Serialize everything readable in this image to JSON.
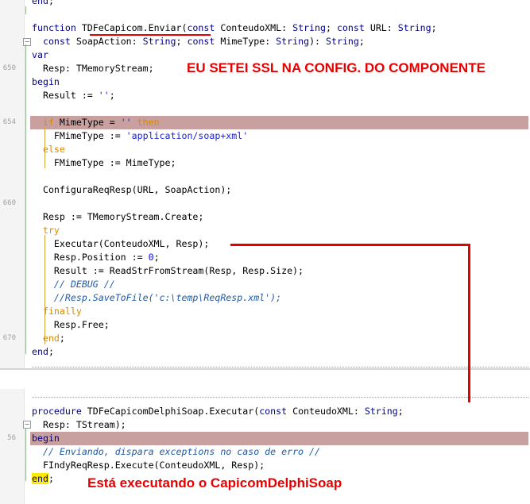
{
  "top": {
    "lines": [
      {
        "ln": "",
        "html": "<span class=\"kw\">end</span>;"
      },
      {
        "ln": "",
        "html": ""
      },
      {
        "ln": "",
        "html": "<span class=\"kw\">function</span> TDFeCapicom.Enviar(<span class=\"kw\">const</span> ConteudoXML: <span class=\"kw\">String</span>; <span class=\"kw\">const</span> URL: <span class=\"kw\">String</span>;"
      },
      {
        "ln": "",
        "html": "  <span class=\"kw\">const</span> SoapAction: <span class=\"kw\">String</span>; <span class=\"kw\">const</span> MimeType: <span class=\"kw\">String</span>): <span class=\"kw\">String</span>;"
      },
      {
        "ln": "",
        "html": "<span class=\"kw\">var</span>"
      },
      {
        "ln": "650",
        "html": "  Resp: TMemoryStream;"
      },
      {
        "ln": "",
        "html": "<span class=\"kw\">begin</span>"
      },
      {
        "ln": "",
        "html": "  Result := <span class=\"str\">''</span>;"
      },
      {
        "ln": "",
        "html": ""
      },
      {
        "ln": "654",
        "html": "  <span class=\"kw-or\">if</span> MimeType = <span class=\"str\">''</span> <span class=\"kw-or\">then</span>"
      },
      {
        "ln": "",
        "html": "    FMimeType := <span class=\"str\">'application/soap+xml'</span>"
      },
      {
        "ln": "",
        "html": "  <span class=\"kw-or\">else</span>"
      },
      {
        "ln": "",
        "html": "    FMimeType := MimeType;"
      },
      {
        "ln": "",
        "html": ""
      },
      {
        "ln": "",
        "html": "  ConfiguraReqResp(URL, SoapAction);"
      },
      {
        "ln": "660",
        "html": ""
      },
      {
        "ln": "",
        "html": "  Resp := TMemoryStream.Create;"
      },
      {
        "ln": "",
        "html": "  <span class=\"kw-or\">try</span>"
      },
      {
        "ln": "",
        "html": "    Executar(ConteudoXML, Resp);"
      },
      {
        "ln": "",
        "html": "    Resp.Position := <span class=\"num\">0</span>;"
      },
      {
        "ln": "",
        "html": "    Result := ReadStrFromStream(Resp, Resp.Size);"
      },
      {
        "ln": "",
        "html": "    <span class=\"cmt\">// DEBUG //</span>"
      },
      {
        "ln": "",
        "html": "    <span class=\"cmt\">//Resp.SaveToFile('c:\\temp\\ReqResp.xml');</span>"
      },
      {
        "ln": "",
        "html": "  <span class=\"kw-or\">finally</span>"
      },
      {
        "ln": "",
        "html": "    Resp.Free;"
      },
      {
        "ln": "670",
        "html": "  <span class=\"kw-or\">end</span>;"
      },
      {
        "ln": "",
        "html": "<span class=\"kw\">end</span>;"
      }
    ]
  },
  "bottom": {
    "lines": [
      {
        "ln": "",
        "html": "<span class=\"kw\">procedure</span> TDFeCapicomDelphiSoap.Executar(<span class=\"kw\">const</span> ConteudoXML: <span class=\"kw\">String</span>;"
      },
      {
        "ln": "",
        "html": "  Resp: TStream);"
      },
      {
        "ln": "56",
        "html": "<span class=\"kw\">begin</span>"
      },
      {
        "ln": "",
        "html": "  <span class=\"cmt\">// Enviando, dispara exceptions no caso de erro //</span>"
      },
      {
        "ln": "",
        "html": "  FIndyReqResp.Execute(ConteudoXML, Resp);"
      },
      {
        "ln": "",
        "html": "<span class=\"kw yellow-mark\">end</span>;"
      }
    ]
  },
  "annotations": {
    "ssl_note": "EU SETEI SSL NA CONFIG. DO COMPONENTE",
    "exec_note": "Está executando o CapicomDelphiSoap"
  },
  "colors": {
    "keyword": "#00008b",
    "flow_keyword": "#d98a00",
    "string": "#1a22d8",
    "comment": "#1e5aa8",
    "highlight": "#c8a0a0",
    "annotation": "#e60000"
  }
}
